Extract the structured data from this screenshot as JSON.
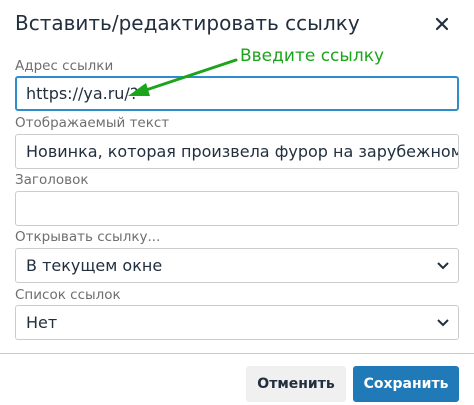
{
  "dialog": {
    "title": "Вставить/редактировать ссылку",
    "close_icon": "close-icon"
  },
  "fields": {
    "url": {
      "label": "Адрес ссылки",
      "value": "https://ya.ru/?"
    },
    "text": {
      "label": "Отображаемый текст",
      "value": "Новинка, которая произвела фурор на зарубежном книжном рынке"
    },
    "title": {
      "label": "Заголовок",
      "value": ""
    },
    "target": {
      "label": "Открывать ссылку...",
      "value": "В текущем окне"
    },
    "link_list": {
      "label": "Список ссылок",
      "value": "Нет"
    }
  },
  "annotation": {
    "text": "Введите ссылку",
    "color": "#1aa51a"
  },
  "footer": {
    "cancel_label": "Отменить",
    "save_label": "Сохранить"
  },
  "colors": {
    "primary": "#207ab7",
    "focus_border": "#2d8ecb",
    "annotation": "#1aa51a"
  }
}
